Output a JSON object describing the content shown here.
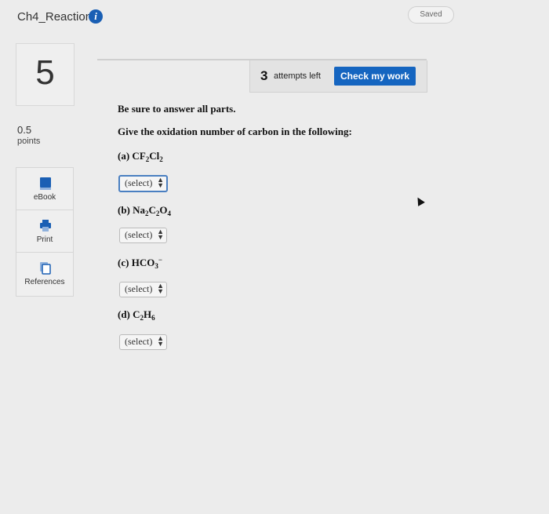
{
  "header": {
    "title": "Ch4_Reaction",
    "info_icon": "info-icon",
    "saved": "Saved"
  },
  "question": {
    "number": "5",
    "points_value": "0.5",
    "points_label": "points"
  },
  "tools": [
    {
      "label": "eBook",
      "icon": "book-icon"
    },
    {
      "label": "Print",
      "icon": "printer-icon"
    },
    {
      "label": "References",
      "icon": "references-icon"
    }
  ],
  "attempts": {
    "count": "3",
    "label": "attempts left"
  },
  "check_button": "Check my work",
  "content": {
    "instruction": "Be sure to answer all parts.",
    "prompt": "Give the oxidation number of carbon in the following:",
    "parts": [
      {
        "prefix": "(a) ",
        "formula": "CF2Cl2",
        "select": "(select)"
      },
      {
        "prefix": "(b) ",
        "formula": "Na2C2O4",
        "select": "(select)"
      },
      {
        "prefix": "(c) ",
        "formula": "HCO3−",
        "select": "(select)"
      },
      {
        "prefix": "(d) ",
        "formula": "C2H6",
        "select": "(select)"
      }
    ]
  },
  "colors": {
    "accent": "#1565c0",
    "background": "#ececec"
  }
}
